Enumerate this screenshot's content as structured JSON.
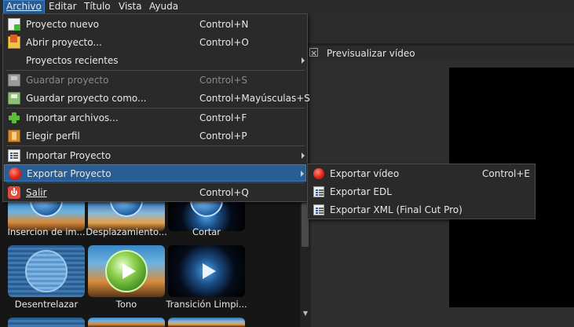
{
  "menubar": {
    "items": [
      "Archivo",
      "Editar",
      "Título",
      "Vista",
      "Ayuda"
    ],
    "active": "Archivo"
  },
  "preview_dock": {
    "title": "Previsualizar vídeo"
  },
  "file_menu": {
    "items": [
      {
        "label": "Proyecto nuevo",
        "shortcut": "Control+N",
        "icon": "new-project-icon"
      },
      {
        "label": "Abrir proyecto...",
        "shortcut": "Control+O",
        "icon": "open-project-icon"
      },
      {
        "label": "Proyectos recientes",
        "shortcut": "",
        "submenu": true
      },
      {
        "label": "Guardar proyecto",
        "shortcut": "Control+S",
        "icon": "save-icon",
        "disabled": true
      },
      {
        "label": "Guardar proyecto como...",
        "shortcut": "Control+Mayúsculas+S",
        "icon": "save-as-icon"
      },
      {
        "label": "Importar archivos...",
        "shortcut": "Control+F",
        "icon": "plus-icon"
      },
      {
        "label": "Elegir perfil",
        "shortcut": "Control+P",
        "icon": "film-icon"
      },
      {
        "label": "Importar Proyecto",
        "shortcut": "",
        "icon": "list-icon",
        "submenu": true
      },
      {
        "label": "Exportar Proyecto",
        "shortcut": "",
        "icon": "record-icon",
        "submenu": true,
        "highlighted": true
      },
      {
        "label": "Salir",
        "shortcut": "Control+Q",
        "icon": "power-icon"
      }
    ]
  },
  "export_submenu": {
    "items": [
      {
        "label": "Exportar vídeo",
        "shortcut": "Control+E",
        "icon": "record-icon"
      },
      {
        "label": "Exportar EDL",
        "shortcut": "",
        "icon": "list-icon"
      },
      {
        "label": "Exportar XML (Final Cut Pro)",
        "shortcut": "",
        "icon": "list-icon"
      }
    ]
  },
  "effects": {
    "row1": [
      "Insercion de im...",
      "Desplazamiento...",
      "Cortar"
    ],
    "row2": [
      "Desentrelazar",
      "Tono",
      "Transición Limpi..."
    ]
  }
}
